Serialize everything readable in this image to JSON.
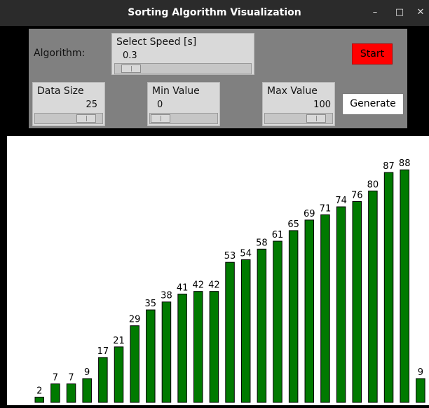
{
  "window": {
    "title": "Sorting Algorithm Visualization",
    "min_glyph": "–",
    "max_glyph": "□",
    "close_glyph": "✕"
  },
  "controls": {
    "algorithm_label": "Algorithm:",
    "speed": {
      "label": "Select Speed [s]",
      "value": "0.3",
      "fraction": 0.05
    },
    "start_label": "Start",
    "data_size": {
      "label": "Data Size",
      "value": "25",
      "fraction": 0.88
    },
    "min_value": {
      "label": "Min Value",
      "value": "0",
      "fraction": 0.0
    },
    "max_value": {
      "label": "Max Value",
      "value": "100",
      "fraction": 0.88
    },
    "generate_label": "Generate"
  },
  "colors": {
    "bar": "#007a00",
    "start": "#ff0000"
  },
  "chart_data": {
    "type": "bar",
    "values": [
      2,
      7,
      7,
      9,
      17,
      21,
      29,
      35,
      38,
      41,
      42,
      42,
      53,
      54,
      58,
      61,
      65,
      69,
      71,
      74,
      76,
      80,
      87,
      88,
      9
    ],
    "ylim": [
      0,
      100
    ]
  }
}
